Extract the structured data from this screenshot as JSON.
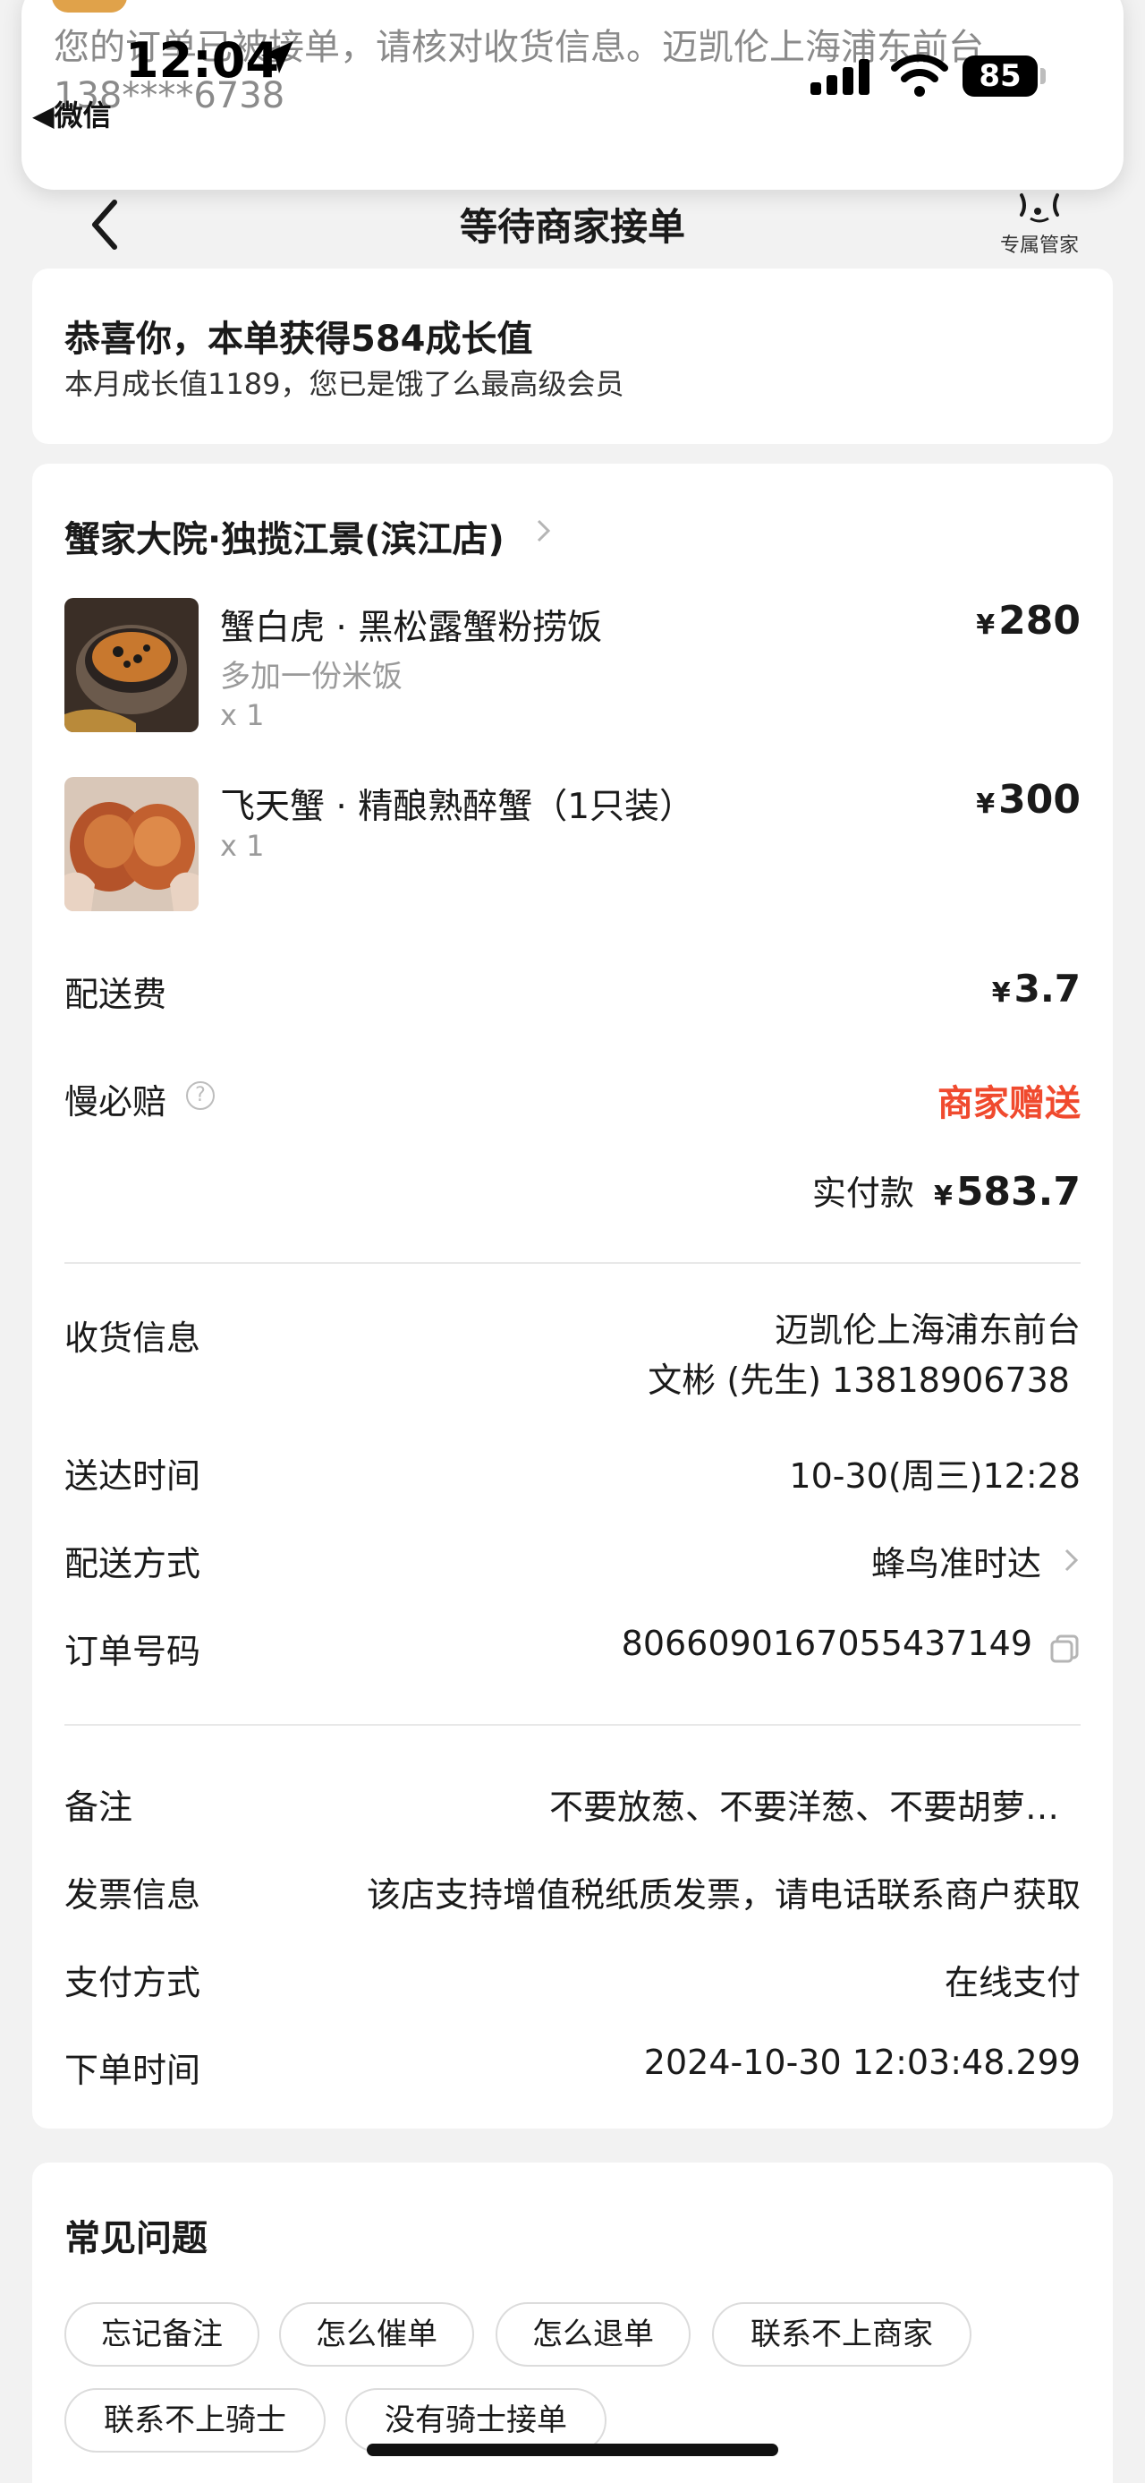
{
  "notification": {
    "line1": "您的订单已被接单，请核对收货信息。迈凯伦上海浦东前台",
    "line2": "138****6738"
  },
  "status_bar": {
    "time": "12:04",
    "back_app": "◀微信",
    "battery": "85"
  },
  "nav": {
    "title": "等待商家接单",
    "butler_label": "专属管家"
  },
  "growth": {
    "title": "恭喜你，本单获得584成长值",
    "subtitle": "本月成长值1189，您已是饿了么最高级会员"
  },
  "order": {
    "shop_name": "蟹家大院·独揽江景(滨江店)",
    "currency": "¥",
    "items": [
      {
        "name": "蟹白虎 · 黑松露蟹粉捞饭",
        "spec": "多加一份米饭",
        "qty": "x 1",
        "price": "280"
      },
      {
        "name": "飞天蟹 · 精酿熟醉蟹（1只装）",
        "spec": "",
        "qty": "x 1",
        "price": "300"
      }
    ],
    "delivery_fee_label": "配送费",
    "delivery_fee": "3.7",
    "slow_comp_label": "慢必赔",
    "slow_comp_value": "商家赠送",
    "total_label": "实付款",
    "total_amount": "583.7"
  },
  "details": {
    "receiver_label": "收货信息",
    "receiver_address": "迈凯伦上海浦东前台",
    "receiver_contact": "文彬 (先生) 13818906738",
    "delivery_time_label": "送达时间",
    "delivery_time": "10-30(周三)12:28",
    "delivery_method_label": "配送方式",
    "delivery_method": "蜂鸟准时达",
    "order_no_label": "订单号码",
    "order_no": "8066090167055437149",
    "remark_label": "备注",
    "remark": "不要放葱、不要洋葱、不要胡萝…",
    "invoice_label": "发票信息",
    "invoice": "该店支持增值税纸质发票，请电话联系商户获取",
    "payment_label": "支付方式",
    "payment": "在线支付",
    "order_time_label": "下单时间",
    "order_time": "2024-10-30 12:03:48.299"
  },
  "faq": {
    "title": "常见问题",
    "chips": [
      "忘记备注",
      "怎么催单",
      "怎么退单",
      "联系不上商家",
      "联系不上骑士",
      "没有骑士接单"
    ]
  },
  "colors": {
    "accent_red": "#f04a2e",
    "background": "#f2f2f2"
  }
}
